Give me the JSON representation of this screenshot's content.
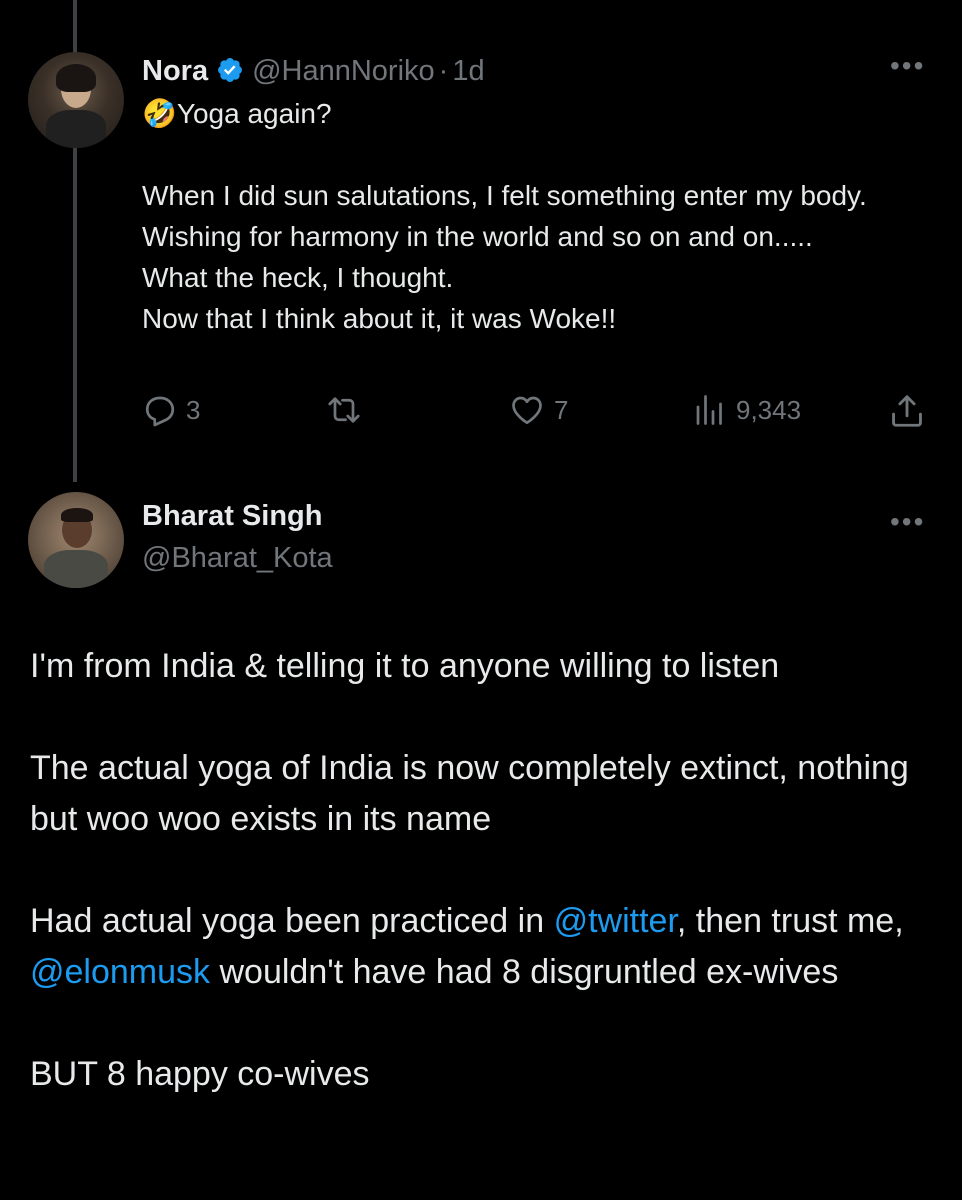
{
  "colors": {
    "background": "#000000",
    "text_primary": "#e7e9ea",
    "text_secondary": "#71767b",
    "link": "#1d9bf0",
    "verified": "#1d9bf0",
    "thread_line": "#3e4144"
  },
  "parent_tweet": {
    "author_name": "Nora",
    "verified_icon": "verified-badge-icon",
    "handle": "@HannNoriko",
    "separator": "·",
    "time": "1d",
    "more_icon": "more-horizontal-icon",
    "emoji": "🤣",
    "first_line": "Yoga again?",
    "body": "When I did sun salutations, I felt something enter my body. Wishing for harmony in the world and so on and on.....\nWhat the heck, I thought.\nNow that I think about it, it was Woke!!",
    "actions": {
      "reply_icon": "reply-icon",
      "reply_count": "3",
      "retweet_icon": "retweet-icon",
      "like_icon": "heart-icon",
      "like_count": "7",
      "views_icon": "views-bar-chart-icon",
      "views_count": "9,343",
      "share_icon": "share-icon"
    }
  },
  "reply_tweet": {
    "author_name": "Bharat Singh",
    "handle": "@Bharat_Kota",
    "more_icon": "more-horizontal-icon",
    "paragraph_1": "I'm from India & telling it to anyone willing to listen",
    "paragraph_2": "The actual yoga of India is now completely extinct, nothing but woo woo exists in its name",
    "paragraph_3_part_1": "Had actual yoga been practiced in ",
    "mention_1": "@twitter",
    "paragraph_3_part_2": ", then trust me, ",
    "mention_2": "@elonmusk",
    "paragraph_3_part_3": " wouldn't have had 8 disgruntled ex-wives",
    "paragraph_4": "BUT 8 happy co-wives"
  }
}
